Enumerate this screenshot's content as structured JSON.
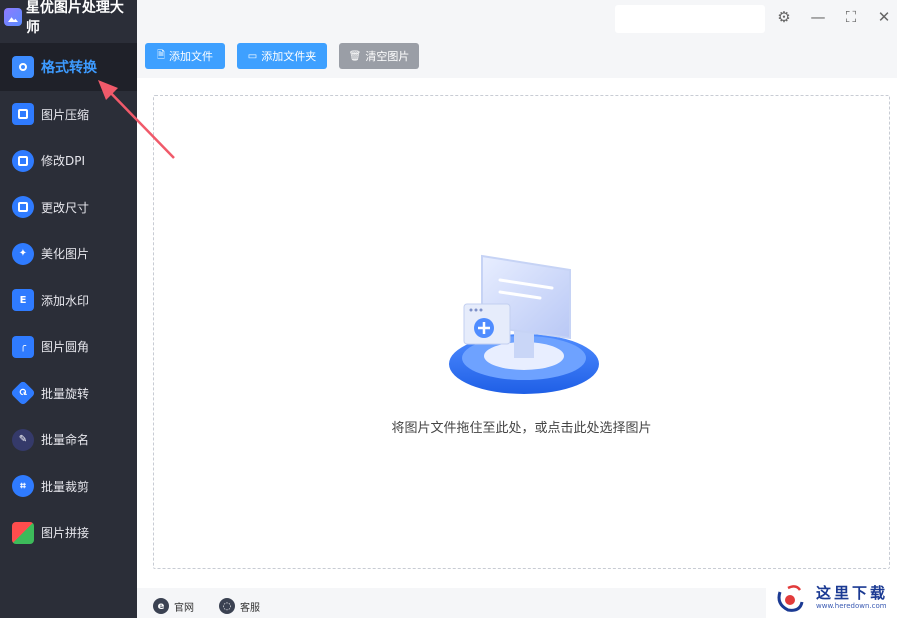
{
  "app": {
    "title": "星优图片处理大师"
  },
  "sidebar": {
    "items": [
      {
        "label": "格式转换",
        "active": true
      },
      {
        "label": "图片压缩"
      },
      {
        "label": "修改DPI"
      },
      {
        "label": "更改尺寸"
      },
      {
        "label": "美化图片"
      },
      {
        "label": "添加水印"
      },
      {
        "label": "图片圆角"
      },
      {
        "label": "批量旋转"
      },
      {
        "label": "批量命名"
      },
      {
        "label": "批量裁剪"
      },
      {
        "label": "图片拼接"
      }
    ]
  },
  "toolbar": {
    "add_file": "添加文件",
    "add_folder": "添加文件夹",
    "clear_images": "清空图片"
  },
  "main": {
    "drop_hint": "将图片文件拖住至此处，或点击此处选择图片"
  },
  "footer": {
    "website": "官网",
    "support": "客服"
  },
  "watermark": {
    "title": "这里下载",
    "site": "www.heredown.com"
  },
  "colors": {
    "sidebar_bg": "#2b2e38",
    "accent": "#3ea0ff",
    "active_text": "#3d9bff",
    "arrow": "#f05a6a"
  }
}
